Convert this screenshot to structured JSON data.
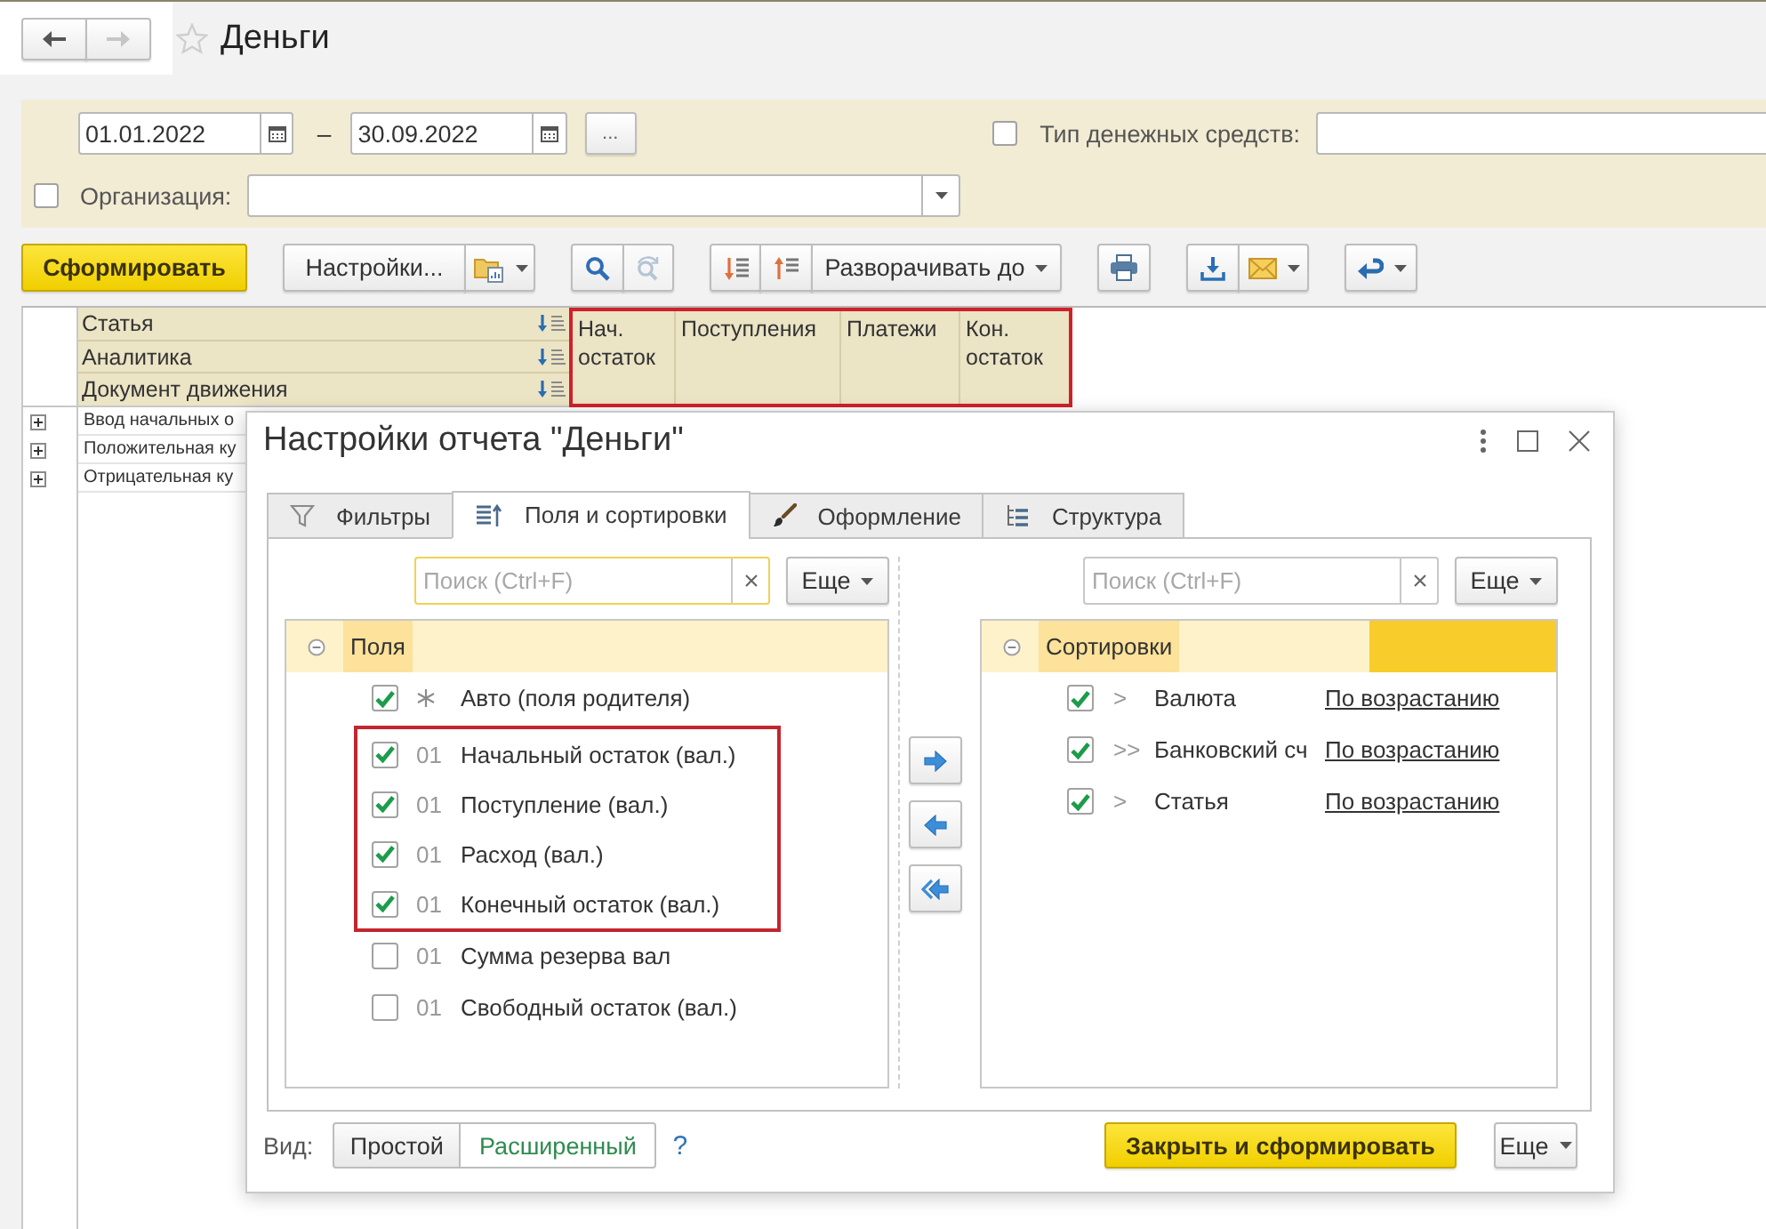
{
  "window": {
    "title": "Деньги",
    "favorite": false,
    "back": {
      "disabled": false
    },
    "forward": {
      "disabled": true
    }
  },
  "filters": {
    "period": {
      "start": "01.01.2022",
      "separator": "–",
      "end": "30.09.2022",
      "choose_button": "..."
    },
    "cash_type": {
      "label": "Тип денежных средств:",
      "checked": false
    },
    "organization": {
      "label": "Организация:",
      "checked": false
    }
  },
  "toolbar": {
    "generate_button": "Сформировать",
    "settings_button": "Настройки...",
    "repeat_search": {
      "disabled": true
    },
    "expand_button": "Разворачивать до"
  },
  "report": {
    "row_headers": [
      "Статья",
      "Аналитика",
      "Документ движения"
    ],
    "columns": [
      "Нач. остаток",
      "Поступления",
      "Платежи",
      "Кон. остаток"
    ],
    "columns_highlighted": true,
    "rows": [
      {
        "label": "Ввод начальных о",
        "expanded": false
      },
      {
        "label": "Положительная ку",
        "expanded": false
      },
      {
        "label": "Отрицательная ку",
        "expanded": false
      }
    ]
  },
  "dialog": {
    "title": "Настройки отчета \"Деньги\"",
    "tabs": [
      {
        "label": "Фильтры",
        "selected": false
      },
      {
        "label": "Поля и сортировки",
        "selected": true
      },
      {
        "label": "Оформление",
        "selected": false
      },
      {
        "label": "Структура",
        "selected": false
      }
    ],
    "fields_panel": {
      "search": {
        "placeholder": "Поиск (Ctrl+F)",
        "focused": true
      },
      "more_button": "Еще",
      "tree": {
        "label": "Поля",
        "expanded": true,
        "selected": true,
        "children": [
          {
            "kind": "auto",
            "label": "Авто (поля родителя)",
            "checked": true,
            "highlighted": false
          },
          {
            "kind": "field",
            "code": "01",
            "label": "Начальный остаток (вал.)",
            "checked": true,
            "highlighted": true
          },
          {
            "kind": "field",
            "code": "01",
            "label": "Поступление (вал.)",
            "checked": true,
            "highlighted": true
          },
          {
            "kind": "field",
            "code": "01",
            "label": "Расход (вал.)",
            "checked": true,
            "highlighted": true
          },
          {
            "kind": "field",
            "code": "01",
            "label": "Конечный остаток (вал.)",
            "checked": true,
            "highlighted": true
          },
          {
            "kind": "field",
            "code": "01",
            "label": "Сумма резерва вал",
            "checked": false,
            "highlighted": false
          },
          {
            "kind": "field",
            "code": "01",
            "label": "Свободный остаток (вал.)",
            "checked": false,
            "highlighted": false
          }
        ]
      }
    },
    "sort_panel": {
      "search": {
        "placeholder": "Поиск (Ctrl+F)",
        "focused": false
      },
      "more_button": "Еще",
      "tree": {
        "label": "Сортировки",
        "expanded": true,
        "selected": true,
        "children": [
          {
            "marker": ">",
            "label": "Валюта",
            "checked": true,
            "direction": "По возрастанию"
          },
          {
            "marker": ">>",
            "label": "Банковский сч",
            "checked": true,
            "direction": "По возрастанию"
          },
          {
            "marker": ">",
            "label": "Статья",
            "checked": true,
            "direction": "По возрастанию"
          }
        ]
      }
    },
    "view": {
      "label": "Вид:",
      "options": [
        {
          "label": "Простой",
          "selected": false
        },
        {
          "label": "Расширенный",
          "selected": true
        }
      ],
      "help": "?"
    },
    "buttons": {
      "primary": "Закрыть и сформировать",
      "more": "Еще"
    }
  }
}
